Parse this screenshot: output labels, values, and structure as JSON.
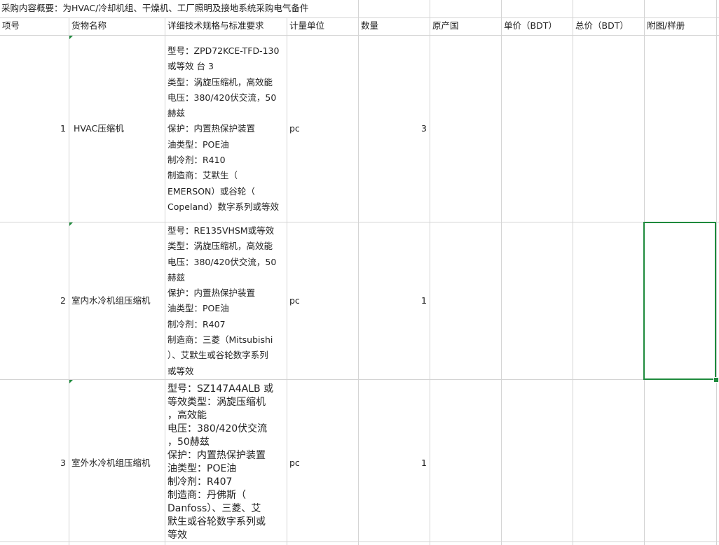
{
  "title": "采购内容概要：为HVAC/冷却机组、干燥机、工厂照明及接地系统采购电气备件",
  "headers": [
    "项号",
    "货物名称",
    "详细技术规格与标准要求",
    "计量单位",
    "数量",
    "原产国",
    "单价（BDT）",
    "总价（BDT）",
    "附图/样册"
  ],
  "rows": [
    {
      "item_no": "1",
      "name": "HVAC压缩机",
      "spec_lines": [
        "型号：ZPD72KCE-TFD-130",
        "或等效 台 3",
        "类型：涡旋压缩机，高效能",
        "电压：380/420伏交流，50",
        "赫兹",
        "保护：内置热保护装置",
        "油类型：POE油",
        "制冷剂：R410",
        "制造商：艾默生（",
        "EMERSON）或谷轮（",
        "Copeland）数字系列或等效"
      ],
      "unit": "pc",
      "qty": "3"
    },
    {
      "item_no": "2",
      "name": "室内水冷机组压缩机",
      "spec_lines": [
        " 型号：RE135VHSM或等效",
        "类型：涡旋压缩机，高效能",
        "电压：380/420伏交流，50",
        "赫兹",
        "保护：内置热保护装置",
        "油类型：POE油",
        "制冷剂：R407",
        "制造商：三菱（Mitsubishi",
        "）、艾默生或谷轮数字系列",
        "或等效"
      ],
      "unit": "pc",
      "qty": "1"
    },
    {
      "item_no": "3",
      "name": "室外水冷机组压缩机",
      "spec_lines": [
        "型号：SZ147A4ALB 或",
        "等效类型：涡旋压缩机",
        "，高效能",
        "电压：380/420伏交流",
        "，50赫兹",
        "保护：内置热保护装置",
        "油类型：POE油",
        "制冷剂：R407",
        "制造商：丹佛斯（",
        "Danfoss）、三菱、艾",
        "默生或谷轮数字系列或",
        "等效"
      ],
      "unit": "pc",
      "qty": "1"
    }
  ]
}
